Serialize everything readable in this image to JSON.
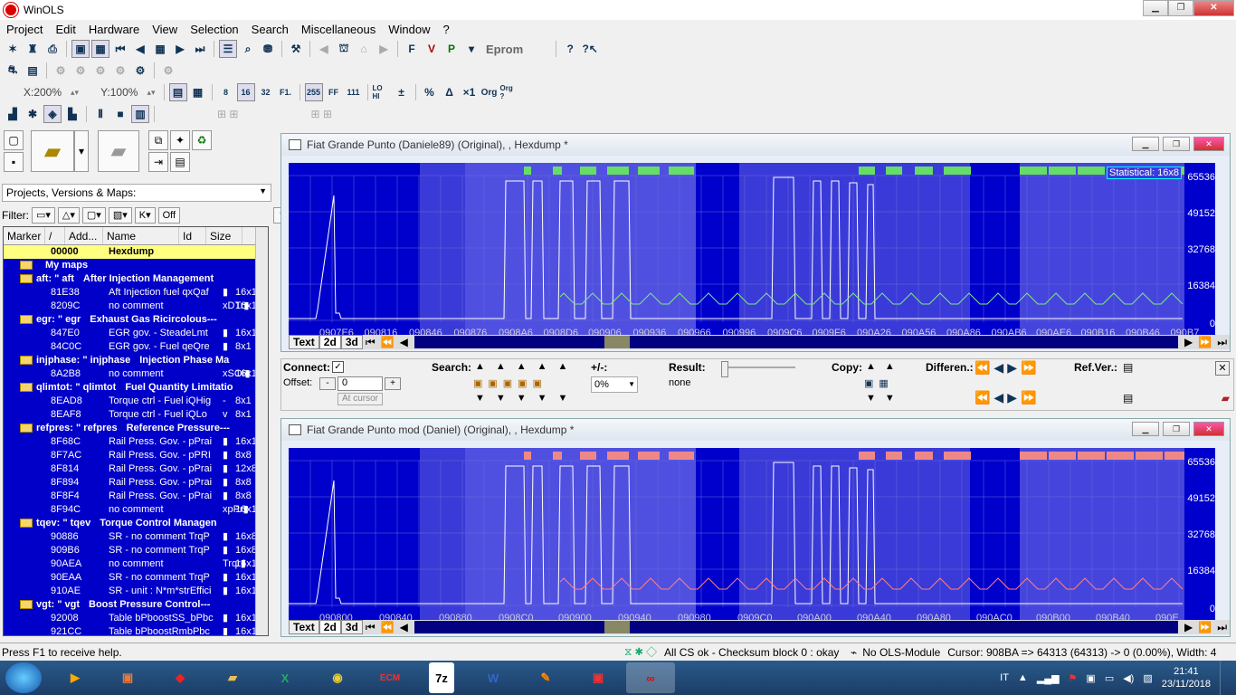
{
  "app": {
    "title": "WinOLS"
  },
  "menu": [
    "Project",
    "Edit",
    "Hardware",
    "View",
    "Selection",
    "Search",
    "Miscellaneous",
    "Window",
    "?"
  ],
  "toolbar": {
    "eprom": "Eprom",
    "x_zoom": "X:200%",
    "y_zoom": "Y:100%",
    "labels": {
      "b8": "8",
      "b16": "16",
      "b32": "32",
      "f1": "F1.",
      "b255": "255",
      "ff": "FF",
      "n111": "111",
      "lohi": "LO HI",
      "pct": "%",
      "delta": "Δ",
      "x1": "×1",
      "org": "Org",
      "orgq": "Org ?"
    }
  },
  "left": {
    "combo": "Projects, Versions & Maps:",
    "filter_label": "Filter:",
    "filter_off": "Off",
    "headers": [
      "Marker",
      "/",
      "Add...",
      "Name",
      "Id",
      "Size"
    ],
    "rows": [
      {
        "type": "sel",
        "addr": "00000",
        "name": "Hexdump",
        "id": "",
        "size": ""
      },
      {
        "type": "folder",
        "addr": "",
        "name": "My maps",
        "id": "",
        "size": ""
      },
      {
        "type": "folder",
        "addr": "aft: \" aft",
        "name": "After Injection Management",
        "id": "",
        "size": ""
      },
      {
        "type": "item",
        "addr": "81E38",
        "name": "Aft Injection fuel qxQaf",
        "id": "▮",
        "size": "16x16"
      },
      {
        "type": "item",
        "addr": "8209C",
        "name": "no comment",
        "id": "xDTr▮",
        "size": "16x16"
      },
      {
        "type": "folder",
        "addr": "egr: \" egr",
        "name": "Exhaust Gas Ricircolous---",
        "id": "",
        "size": ""
      },
      {
        "type": "item",
        "addr": "847E0",
        "name": "EGR gov. - SteadeLmt",
        "id": "▮",
        "size": "16x16"
      },
      {
        "type": "item",
        "addr": "84C0C",
        "name": "EGR gov. - Fuel qeQre",
        "id": "▮",
        "size": "8x1"
      },
      {
        "type": "folder",
        "addr": "injphase: \" injphase",
        "name": "Injection Phase Ma",
        "id": "",
        "size": ""
      },
      {
        "type": "item",
        "addr": "8A2B8",
        "name": "no comment",
        "id": "xSOI▮",
        "size": "16x16"
      },
      {
        "type": "folder",
        "addr": "qlimtot: \" qlimtot",
        "name": "Fuel Quantity Limitatio",
        "id": "",
        "size": ""
      },
      {
        "type": "item",
        "addr": "8EAD8",
        "name": "Torque ctrl - Fuel iQHig",
        "id": "-",
        "size": "8x1"
      },
      {
        "type": "item",
        "addr": "8EAF8",
        "name": "Torque ctrl - Fuel iQLo",
        "id": "v",
        "size": "8x1"
      },
      {
        "type": "folder",
        "addr": "refpres: \" refpres",
        "name": "Reference Pressure---",
        "id": "",
        "size": ""
      },
      {
        "type": "item",
        "addr": "8F68C",
        "name": "Rail Press. Gov. - pPrai",
        "id": "▮",
        "size": "16x16"
      },
      {
        "type": "item",
        "addr": "8F7AC",
        "name": "Rail Press. Gov. - pPRI",
        "id": "▮",
        "size": "8x8"
      },
      {
        "type": "item",
        "addr": "8F814",
        "name": "Rail Press. Gov. - pPrai",
        "id": "▮",
        "size": "12x8"
      },
      {
        "type": "item",
        "addr": "8F894",
        "name": "Rail Press. Gov. - pPrai",
        "id": "▮",
        "size": "8x8"
      },
      {
        "type": "item",
        "addr": "8F8F4",
        "name": "Rail Press. Gov. - pPrai",
        "id": "▮",
        "size": "8x8"
      },
      {
        "type": "item",
        "addr": "8F94C",
        "name": "no comment",
        "id": "xpPr▮",
        "size": "16x16"
      },
      {
        "type": "folder",
        "addr": "tqev: \" tqev",
        "name": "Torque Control Managen",
        "id": "",
        "size": ""
      },
      {
        "type": "item",
        "addr": "90886",
        "name": "SR - no comment TrqP",
        "id": "▮",
        "size": "16x8"
      },
      {
        "type": "item",
        "addr": "909B6",
        "name": "SR - no comment TrqP",
        "id": "▮",
        "size": "16x8"
      },
      {
        "type": "item",
        "addr": "90AEA",
        "name": "no comment",
        "id": "Trqr▮",
        "size": "16x10"
      },
      {
        "type": "item",
        "addr": "90EAA",
        "name": "SR - no comment TrqP",
        "id": "▮",
        "size": "16x10"
      },
      {
        "type": "item",
        "addr": "910AE",
        "name": "SR - unit : N*m*strEffici",
        "id": "▮",
        "size": "16x16"
      },
      {
        "type": "folder",
        "addr": "vgt: \" vgt",
        "name": "Boost Pressure Control---",
        "id": "",
        "size": ""
      },
      {
        "type": "item",
        "addr": "92008",
        "name": "Table bPboostSS_bPbc",
        "id": "▮",
        "size": "16x16"
      },
      {
        "type": "item",
        "addr": "921CC",
        "name": "Table bPboostRmbPbc",
        "id": "▮",
        "size": "16x10"
      }
    ]
  },
  "win1": {
    "title": "Fiat Grande Punto (Daniele89) (Original), , Hexdump *",
    "stat_label": "Statistical: 16x8",
    "yticks": [
      "65536",
      "49152",
      "32768",
      "16384",
      "0"
    ],
    "xticks": [
      "0907E6",
      "090816",
      "090846",
      "090876",
      "0908A6",
      "0908D6",
      "090906",
      "090936",
      "090966",
      "090996",
      "0909C6",
      "0909F6",
      "090A26",
      "090A56",
      "090A86",
      "090AB6",
      "090AE6",
      "090B16",
      "090B46",
      "090B7"
    ]
  },
  "win2": {
    "title": "Fiat Grande Punto mod (Daniel) (Original), , Hexdump *",
    "yticks": [
      "65536",
      "49152",
      "32768",
      "16384",
      "0"
    ],
    "xticks": [
      "090800",
      "090840",
      "090880",
      "0908C0",
      "090900",
      "090940",
      "090980",
      "0909C0",
      "090A00",
      "090A40",
      "090A80",
      "090AC0",
      "090B00",
      "090B40",
      "090E"
    ]
  },
  "tabs": [
    "Text",
    "2d",
    "3d"
  ],
  "connect": {
    "label": "Connect:",
    "offset_label": "Offset:",
    "offset_value": "0",
    "at_cursor": "At cursor",
    "search_label": "Search:",
    "plusminus_label": "+/-:",
    "plusminus_value": "0%",
    "result_label": "Result:",
    "result_value": "none",
    "copy_label": "Copy:",
    "differen_label": "Differen.:",
    "refver_label": "Ref.Ver.:"
  },
  "status": {
    "help": "Press F1 to receive help.",
    "checksum": "All CS ok - Checksum block 0 : okay",
    "module": "No OLS-Module",
    "cursor": "Cursor: 908BA => 64313 (64313) -> 0 (0.00%), Width: 4"
  },
  "taskbar": {
    "lang": "IT",
    "time": "21:41",
    "date": "23/11/2018"
  }
}
